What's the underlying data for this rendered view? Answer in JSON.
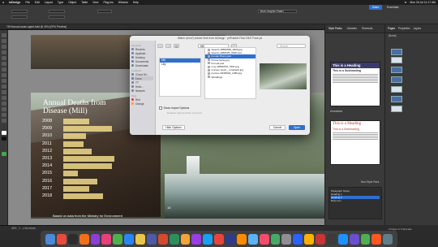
{
  "menubar": {
    "app": "InDesign",
    "items": [
      "File",
      "Edit",
      "Layout",
      "Type",
      "Object",
      "Table",
      "View",
      "Plug-ins",
      "Window",
      "Help"
    ],
    "clock": "Mon 26 Jul 11:17 AM"
  },
  "app_title": "Adobe InDesign 2024",
  "control": {
    "font": "Bree Graphic Pastel",
    "share": "Share",
    "essentials": "Essentials"
  },
  "doc_tab": "*39 Annual-cause-agent.indd @ 42% [GPU Preview]",
  "dialog": {
    "title": "Watch: (b/ca?) Adobe Smb from inDesign · pt/Frankin Flow·2/4/0 P.ase.pd",
    "sidebar": {
      "favorites_label": "Favorites",
      "favorites": [
        "Recents",
        "Applicati...",
        "Desktop",
        "Documents",
        "Downloads"
      ],
      "locations_label": "Locations",
      "locations": [
        "iCloud Dri...",
        "Linux",
        "TT",
        "Hello...",
        "Network"
      ],
      "tags_label": "Tags",
      "tags": [
        "Red",
        "Orange"
      ]
    },
    "location": "Mill",
    "search_placeholder": "Search",
    "column1": [
      "Mill",
      "Lilly"
    ],
    "column2": [
      "Search~RB50595_0626.jpg",
      "Search~RB5505_0628.psd",
      "Fonder Blurry.psd",
      "Pixma Spray.jpg",
      "Format.psd",
      "mce~RB50578_7597.jpg",
      "maroon.stock._.unsplash.jpg",
      "punset~RF05092_1086.jpg",
      "Weddings"
    ],
    "column2_selected": 2,
    "show_import_options": "Show Import Options",
    "replace_selected": "Replace Selected Item   Link Item",
    "hide_options": "Hide Options",
    "cancel": "Cancel",
    "open": "Open"
  },
  "chart_data": {
    "type": "bar",
    "title": "Annual Deaths from\nDisease (Mill)",
    "categories": [
      "2008",
      "2009",
      "2010",
      "2011",
      "2012",
      "2013",
      "2014",
      "2015",
      "2016",
      "2017",
      "2018"
    ],
    "values": [
      9,
      17,
      8,
      7,
      10,
      18,
      17,
      5,
      12,
      9,
      14
    ],
    "xlim": [
      0,
      20
    ],
    "footnote": "Based on data from the Ministry for Environment",
    "page_number": "10",
    "bar_color": "#f0d98a"
  },
  "right_panel": {
    "tabs": [
      "Style Packs",
      "Libraries",
      "Shortcuts"
    ],
    "style1": {
      "heading": "This is a Heading",
      "subheading": "This is a Subheading"
    },
    "style_caption": "Annotation",
    "style2": {
      "heading": "This is a Heading",
      "subheading": "This is a Subheading"
    },
    "new_style_pack": "New Style Pack",
    "search_items": [
      "Paragraph Styles",
      "Heading 1",
      "Heading 2",
      "Body text"
    ]
  },
  "pages_panel": {
    "tabs": [
      "Pages",
      "Properties",
      "Layers"
    ],
    "none": "[None]",
    "status": "9 Pages in 6 Spreads"
  },
  "status_bar": {
    "zoom": "42%",
    "page": "1",
    "errors": "No errors"
  },
  "dock_colors": [
    "#4a8ad8",
    "#e94a3c",
    "#2c2c2c",
    "#f36f1a",
    "#8b3fd8",
    "#e83f7a",
    "#4fb04a",
    "#2a86f5",
    "#e9c54a",
    "#4e5aa8",
    "#d34b2c",
    "#2d8f5b",
    "#f2a33a",
    "#9b3de6",
    "#18a0f5",
    "#e7453b",
    "#2e3b8a",
    "#ff8a00",
    "#5cb3f5",
    "#f24e6c",
    "#44aa66",
    "#8e8e93",
    "#2962ff",
    "#ffb100",
    "#c93434",
    "#3b3b3b",
    "#1d92ff",
    "#6b4fcf",
    "#4caf50",
    "#ff5722",
    "#607d8b"
  ]
}
